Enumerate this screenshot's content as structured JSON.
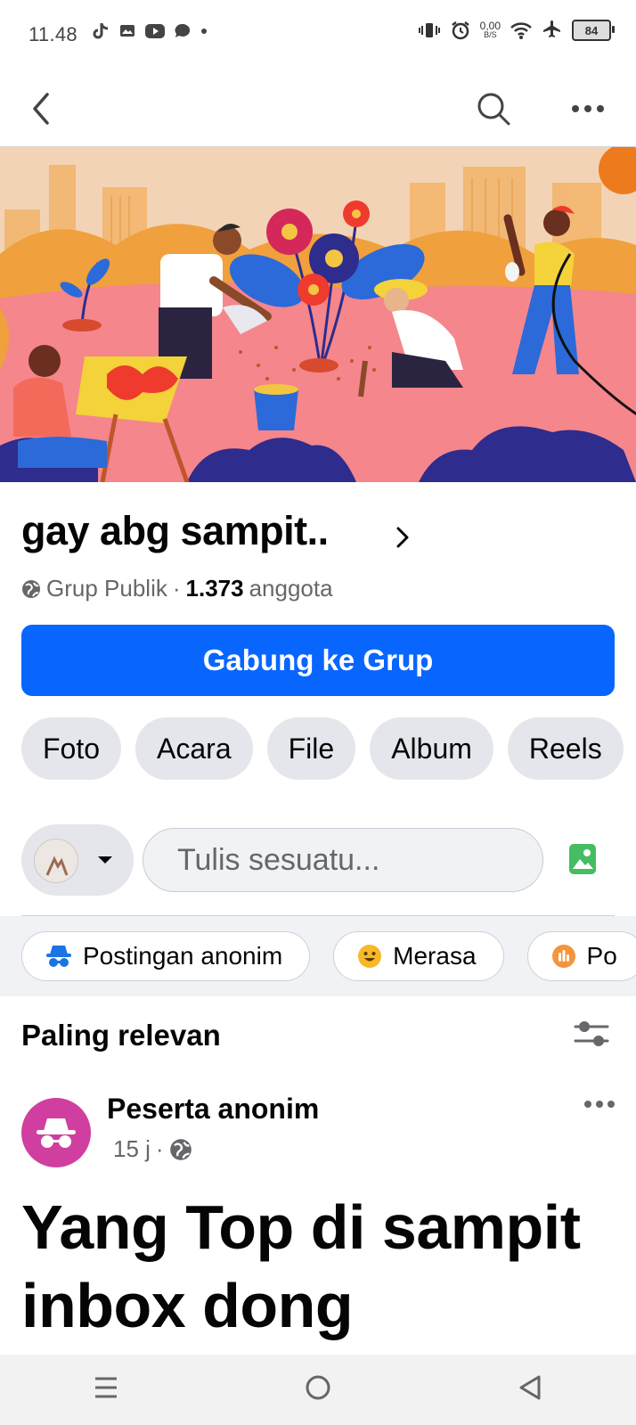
{
  "status": {
    "time": "11.48",
    "net_speed_value": "0,00",
    "net_speed_unit": "B/S",
    "battery": "84"
  },
  "group": {
    "name": "gay abg sampit..",
    "privacy": "Grup Publik",
    "member_count": "1.373",
    "member_label": "anggota",
    "join_label": "Gabung ke Grup"
  },
  "tabs": [
    {
      "label": "Foto"
    },
    {
      "label": "Acara"
    },
    {
      "label": "File"
    },
    {
      "label": "Album"
    },
    {
      "label": "Reels"
    }
  ],
  "composer": {
    "placeholder": "Tulis sesuatu..."
  },
  "actions": [
    {
      "label": "Postingan anonim",
      "icon": "anonymous-icon"
    },
    {
      "label": "Merasa",
      "icon": "smile-icon"
    },
    {
      "label": "Po",
      "icon": "poll-icon"
    }
  ],
  "sort": {
    "label": "Paling relevan"
  },
  "post": {
    "author": "Peserta anonim",
    "time": "15 j",
    "text": "Yang Top di sampit inbox dong"
  },
  "colors": {
    "primary": "#0866ff",
    "anon_avatar": "#d03f9f",
    "chip_bg": "#e4e6eb"
  }
}
